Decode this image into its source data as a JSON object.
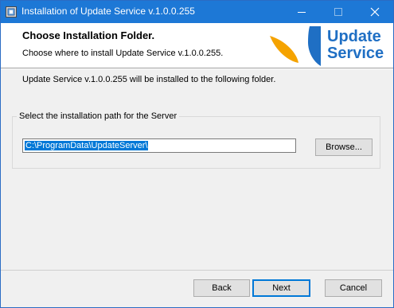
{
  "window": {
    "title": "Installation of Update Service v.1.0.0.255"
  },
  "header": {
    "title": "Choose Installation Folder.",
    "subtitle": "Choose where to install Update Service v.1.0.0.255.",
    "logo_line1": "Update",
    "logo_line2": "Service"
  },
  "main": {
    "info": "Update Service v.1.0.0.255 will be installed to the following folder.",
    "group_label": "Select the installation path for the Server",
    "path_value": "C:\\ProgramData\\UpdateServer\\",
    "browse_label": "Browse..."
  },
  "footer": {
    "back_label": "Back",
    "next_label": "Next",
    "cancel_label": "Cancel"
  },
  "colors": {
    "titlebar": "#1d78d6",
    "logo_blue": "#1f6fc4",
    "logo_orange": "#f5a300"
  },
  "icons": {
    "app": "installer-icon",
    "minimize": "minimize-icon",
    "maximize": "maximize-icon",
    "close": "close-icon"
  }
}
